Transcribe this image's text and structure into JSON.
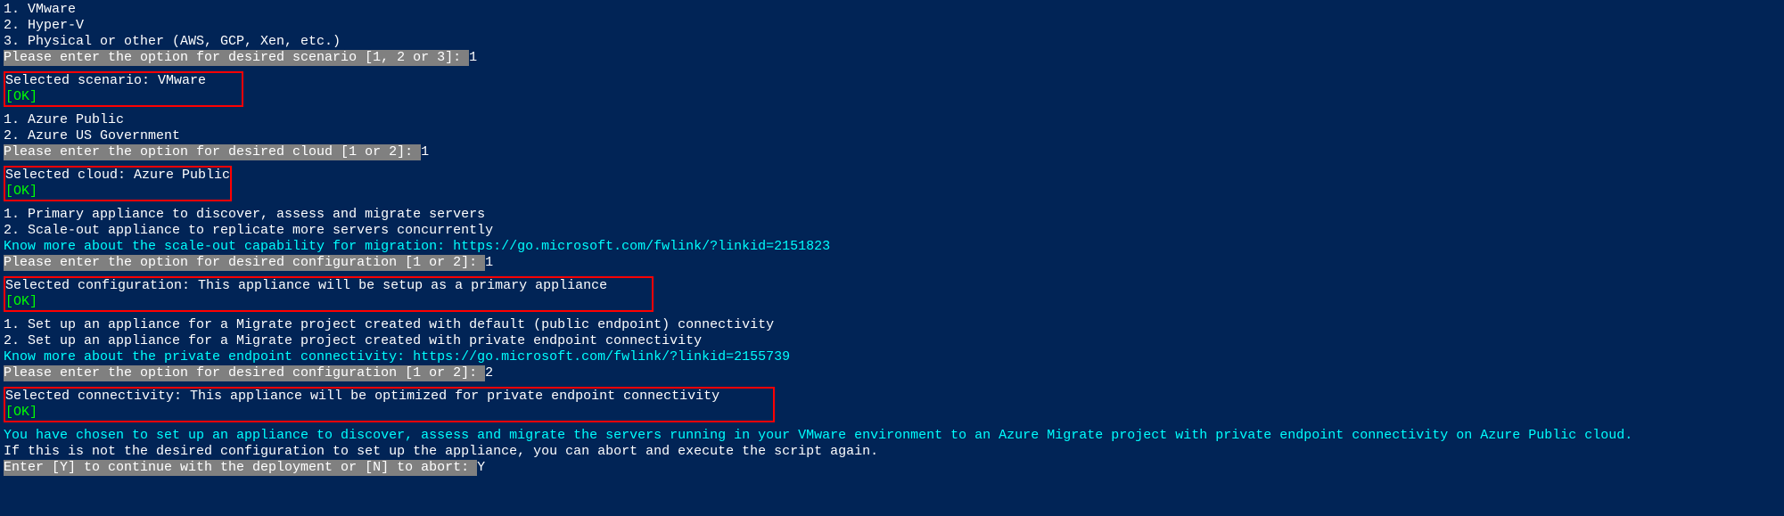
{
  "scenario": {
    "opt1": "1. VMware",
    "opt2": "2. Hyper-V",
    "opt3": "3. Physical or other (AWS, GCP, Xen, etc.)",
    "prompt": "Please enter the option for desired scenario [1, 2 or 3]: ",
    "input": "1",
    "selected": "Selected scenario: VMware",
    "ok": "[OK]"
  },
  "cloud": {
    "opt1": "1. Azure Public",
    "opt2": "2. Azure US Government",
    "prompt": "Please enter the option for desired cloud [1 or 2]: ",
    "input": "1",
    "selected": "Selected cloud: Azure Public",
    "ok": "[OK]"
  },
  "config": {
    "opt1": "1. Primary appliance to discover, assess and migrate servers",
    "opt2": "2. Scale-out appliance to replicate more servers concurrently",
    "know": "Know more about the scale-out capability for migration: https://go.microsoft.com/fwlink/?linkid=2151823",
    "prompt": "Please enter the option for desired configuration [1 or 2]: ",
    "input": "1",
    "selected": "Selected configuration: This appliance will be setup as a primary appliance",
    "ok": "[OK]"
  },
  "connectivity": {
    "opt1": "1. Set up an appliance for a Migrate project created with default (public endpoint) connectivity",
    "opt2": "2. Set up an appliance for a Migrate project created with private endpoint connectivity",
    "know": "Know more about the private endpoint connectivity: https://go.microsoft.com/fwlink/?linkid=2155739",
    "prompt": "Please enter the option for desired configuration [1 or 2]: ",
    "input": "2",
    "selected": "Selected connectivity: This appliance will be optimized for private endpoint connectivity",
    "ok": "[OK]"
  },
  "summary": {
    "line1": "You have chosen to set up an appliance to discover, assess and migrate the servers running in your VMware environment to an Azure Migrate project with private endpoint connectivity on Azure Public cloud.",
    "line2": "If this is not the desired configuration to set up the appliance, you can abort and execute the script again.",
    "prompt": "Enter [Y] to continue with the deployment or [N] to abort: ",
    "input": "Y"
  }
}
